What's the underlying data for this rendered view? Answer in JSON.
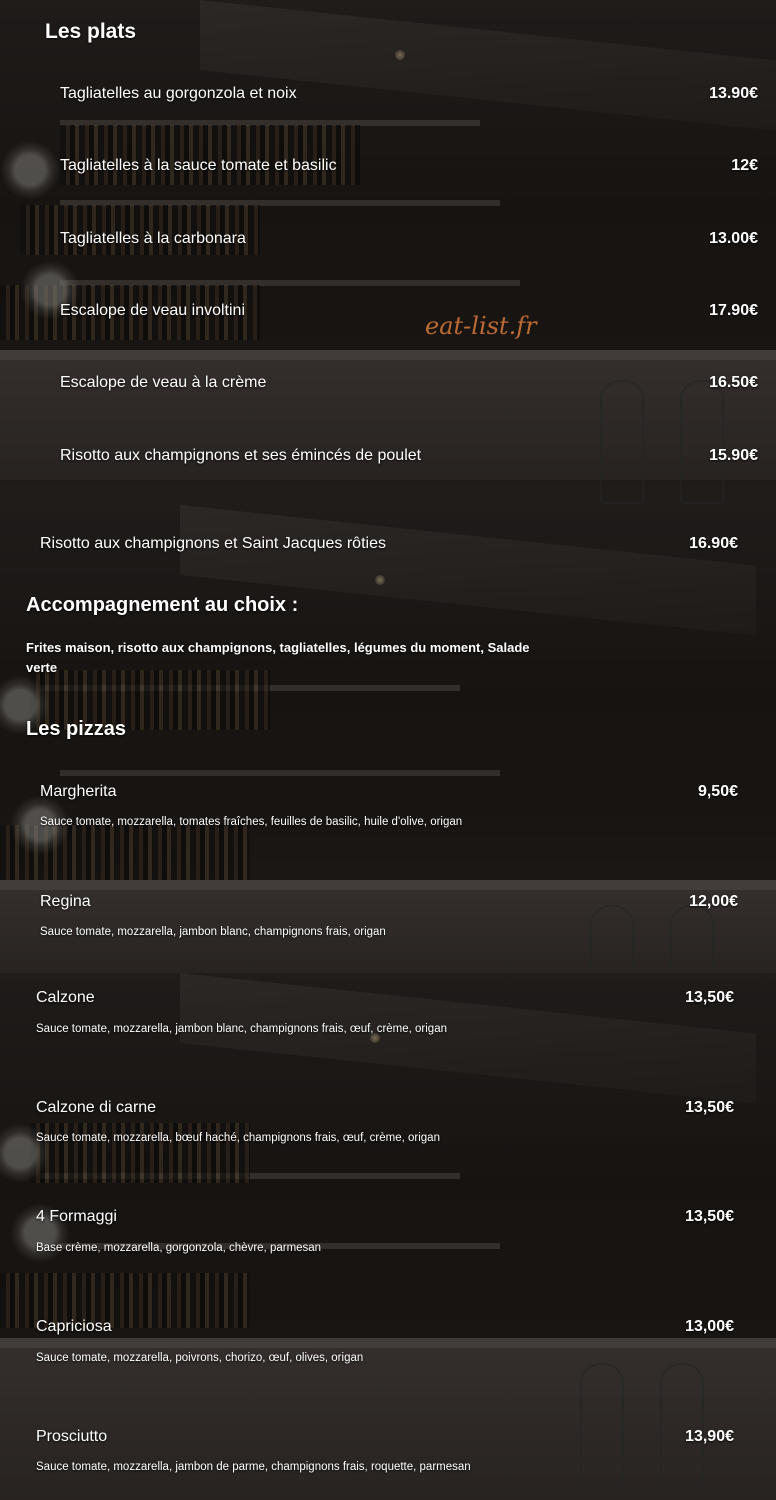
{
  "watermark": "eat-list.fr",
  "plats": {
    "heading": "Les plats",
    "items": [
      {
        "name": "Tagliatelles au gorgonzola et noix",
        "price": "13.90€"
      },
      {
        "name": "Tagliatelles à la sauce tomate et basilic",
        "price": "12€"
      },
      {
        "name": "Tagliatelles à la carbonara",
        "price": "13.00€"
      },
      {
        "name": "Escalope de veau involtini",
        "price": "17.90€"
      },
      {
        "name": "Escalope de veau à la crème",
        "price": "16.50€"
      },
      {
        "name": "Risotto aux champignons et ses émincés de poulet",
        "price": "15.90€"
      },
      {
        "name": "Risotto aux champignons et Saint Jacques rôties",
        "price": "16.90€"
      }
    ]
  },
  "accompagnement": {
    "heading": "Accompagnement au choix :",
    "text": "Frites maison, risotto aux champignons, tagliatelles, légumes du moment, Salade verte"
  },
  "pizzas": {
    "heading": "Les pizzas",
    "items": [
      {
        "name": "Margherita",
        "price": "9,50€",
        "desc": "Sauce tomate, mozzarella, tomates fraîches, feuilles de basilic, huile d'olive, origan"
      },
      {
        "name": "Regina",
        "price": "12,00€",
        "desc": "Sauce tomate, mozzarella, jambon blanc, champignons frais, origan"
      },
      {
        "name": "Calzone",
        "price": "13,50€",
        "desc": "Sauce tomate, mozzarella, jambon blanc, champignons frais, œuf, crème, origan"
      },
      {
        "name": "Calzone di carne",
        "price": "13,50€",
        "desc": "Sauce tomate, mozzarella, bœuf haché, champignons frais, œuf, crème, origan"
      },
      {
        "name": "4 Formaggi",
        "price": "13,50€",
        "desc": "Base crème, mozzarella, gorgonzola, chèvre, parmesan"
      },
      {
        "name": "Capriciosa",
        "price": "13,00€",
        "desc": "Sauce tomate, mozzarella, poivrons, chorizo, œuf, olives, origan"
      },
      {
        "name": "Prosciutto",
        "price": "13,90€",
        "desc": "Sauce tomate, mozzarella, jambon de parme, champignons frais, roquette, parmesan"
      }
    ]
  }
}
